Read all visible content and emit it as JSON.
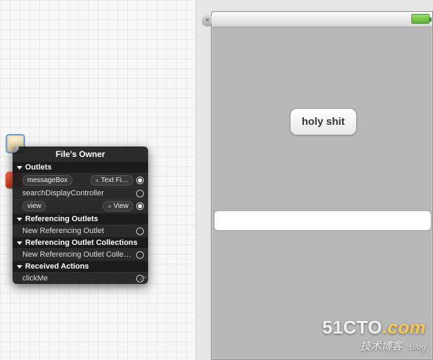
{
  "panel": {
    "title": "File's Owner",
    "sections": [
      {
        "title": "Outlets",
        "rows": [
          {
            "label": "messageBox",
            "connected_to": "Text Fi…",
            "filled": true
          },
          {
            "label": "searchDisplayController",
            "connected_to": null,
            "filled": false
          },
          {
            "label": "view",
            "connected_to": "View",
            "filled": true
          }
        ]
      },
      {
        "title": "Referencing Outlets",
        "rows": [
          {
            "label": "New Referencing Outlet",
            "connected_to": null,
            "filled": false
          }
        ]
      },
      {
        "title": "Referencing Outlet Collections",
        "rows": [
          {
            "label": "New Referencing Outlet Colle…",
            "connected_to": null,
            "filled": false
          }
        ]
      },
      {
        "title": "Received Actions",
        "rows": [
          {
            "label": "clickMe",
            "connected_to": null,
            "filled": false
          }
        ]
      }
    ]
  },
  "simulator": {
    "button_label": "holy shit",
    "textfield_value": ""
  },
  "watermark": {
    "brand_a": "51CTO",
    "brand_b": ".com",
    "line2": "技术博客",
    "line2_b": "Blog"
  }
}
